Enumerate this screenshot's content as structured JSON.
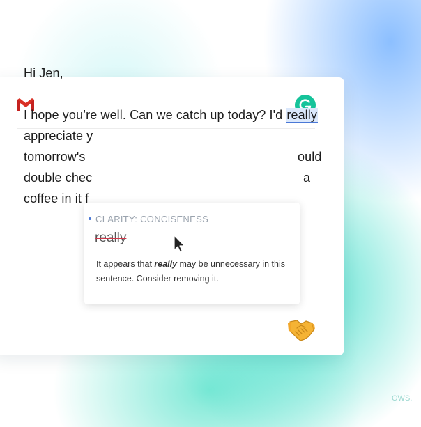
{
  "email": {
    "greeting": "Hi Jen,",
    "lines": {
      "l1_before": "I hope you’re well. Can we catch up today? I'd ",
      "l1_highlight": "really",
      "l2_left": "appreciate y",
      "l3_left": "tomorrow's",
      "l3_right": "ould",
      "l4_left": "double chec",
      "l4_right": "a",
      "l5_left": "coffee in it f"
    }
  },
  "suggestion": {
    "category": "CLARITY: CONCISENESS",
    "word": "really",
    "desc_before": "It appears that ",
    "desc_word": "really",
    "desc_after": " may be unnecessary in this sentence. Consider removing it."
  },
  "watermark": "OWS.",
  "icons": {
    "gmail": "gmail-logo-icon",
    "grammarly": "grammarly-logo-icon",
    "cursor": "mouse-pointer-icon",
    "handshake": "handshake-emoji-icon"
  },
  "colors": {
    "highlight_bg": "#dbe8fb",
    "underline": "#4a78d6",
    "strike": "#d23b4d",
    "grammarly_green": "#15c39a",
    "gmail_red": "#d93025"
  }
}
